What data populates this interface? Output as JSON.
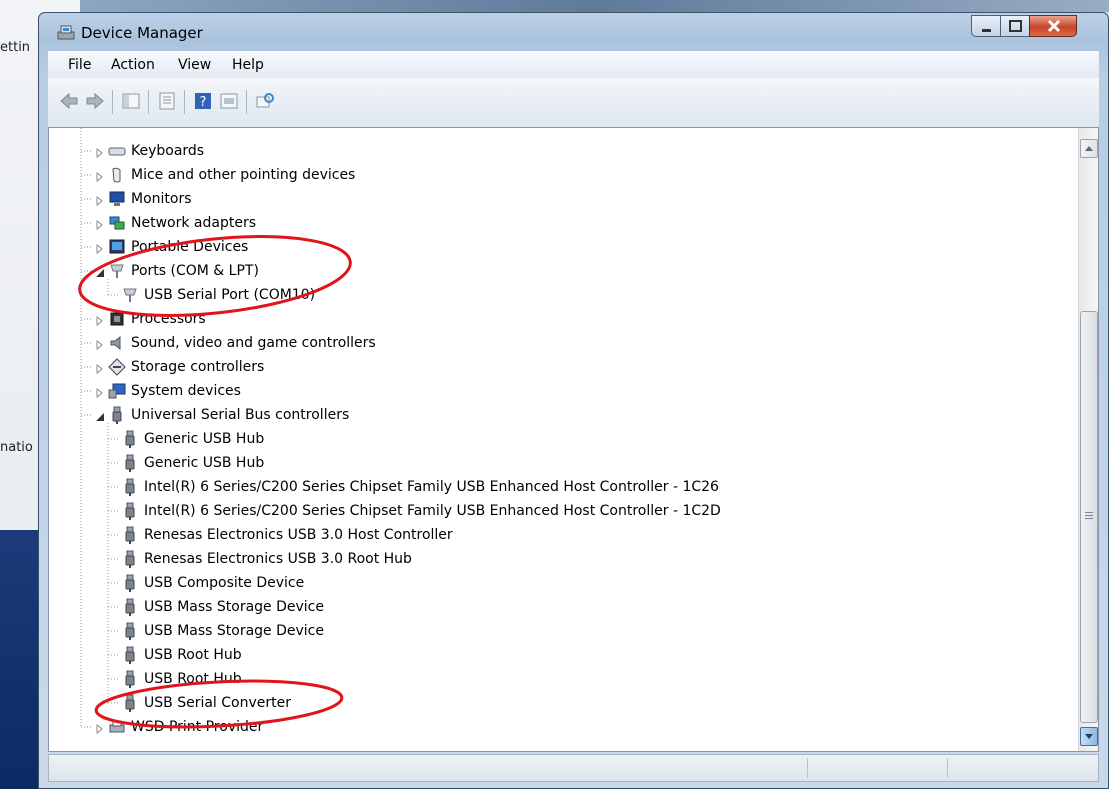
{
  "background": {
    "left_text_top": "ettin",
    "left_text_mid": "natio"
  },
  "window": {
    "title": "Device Manager",
    "icon": "device-manager-icon",
    "controls": [
      "minimize-icon",
      "maximize-icon",
      "close-icon"
    ]
  },
  "menu": {
    "file": "File",
    "action": "Action",
    "view": "View",
    "help": "Help"
  },
  "toolbar": {
    "buttons": [
      "back-arrow-icon",
      "forward-arrow-icon",
      "show-hide-tree-icon",
      "properties-icon",
      "help-icon",
      "update-driver-icon",
      "scan-hardware-icon"
    ]
  },
  "tree": {
    "nodes": [
      {
        "label": "Keyboards",
        "icon": "keyboard-icon",
        "expanded": false
      },
      {
        "label": "Mice and other pointing devices",
        "icon": "mouse-icon",
        "expanded": false
      },
      {
        "label": "Monitors",
        "icon": "monitor-icon",
        "expanded": false
      },
      {
        "label": "Network adapters",
        "icon": "network-icon",
        "expanded": false
      },
      {
        "label": "Portable Devices",
        "icon": "portable-device-icon",
        "expanded": false
      },
      {
        "label": "Ports (COM & LPT)",
        "icon": "port-icon",
        "expanded": true
      },
      {
        "label": "USB Serial Port (COM10)",
        "icon": "port-icon",
        "child": true
      },
      {
        "label": "Processors",
        "icon": "processor-icon",
        "expanded": false
      },
      {
        "label": "Sound, video and game controllers",
        "icon": "speaker-icon",
        "expanded": false
      },
      {
        "label": "Storage controllers",
        "icon": "storage-icon",
        "expanded": false
      },
      {
        "label": "System devices",
        "icon": "system-icon",
        "expanded": false
      },
      {
        "label": "Universal Serial Bus controllers",
        "icon": "usb-icon",
        "expanded": true
      },
      {
        "label": "Generic USB Hub",
        "icon": "usb-icon",
        "child": true
      },
      {
        "label": "Generic USB Hub",
        "icon": "usb-icon",
        "child": true
      },
      {
        "label": "Intel(R) 6 Series/C200 Series Chipset Family USB Enhanced Host Controller - 1C26",
        "icon": "usb-icon",
        "child": true
      },
      {
        "label": "Intel(R) 6 Series/C200 Series Chipset Family USB Enhanced Host Controller - 1C2D",
        "icon": "usb-icon",
        "child": true
      },
      {
        "label": "Renesas Electronics USB 3.0 Host Controller",
        "icon": "usb-icon",
        "child": true
      },
      {
        "label": "Renesas Electronics USB 3.0 Root Hub",
        "icon": "usb-icon",
        "child": true
      },
      {
        "label": "USB Composite Device",
        "icon": "usb-icon",
        "child": true
      },
      {
        "label": "USB Mass Storage Device",
        "icon": "usb-icon",
        "child": true
      },
      {
        "label": "USB Mass Storage Device",
        "icon": "usb-icon",
        "child": true
      },
      {
        "label": "USB Root Hub",
        "icon": "usb-icon",
        "child": true
      },
      {
        "label": "USB Root Hub",
        "icon": "usb-icon",
        "child": true
      },
      {
        "label": "USB Serial Converter",
        "icon": "usb-icon",
        "child": true
      },
      {
        "label": "WSD Print Provider",
        "icon": "printer-icon",
        "expanded": false
      }
    ]
  },
  "annotations": {
    "color": "#e0141b",
    "circled": [
      "Ports (COM & LPT)",
      "USB Serial Port (COM10)",
      "USB Serial Converter"
    ]
  }
}
